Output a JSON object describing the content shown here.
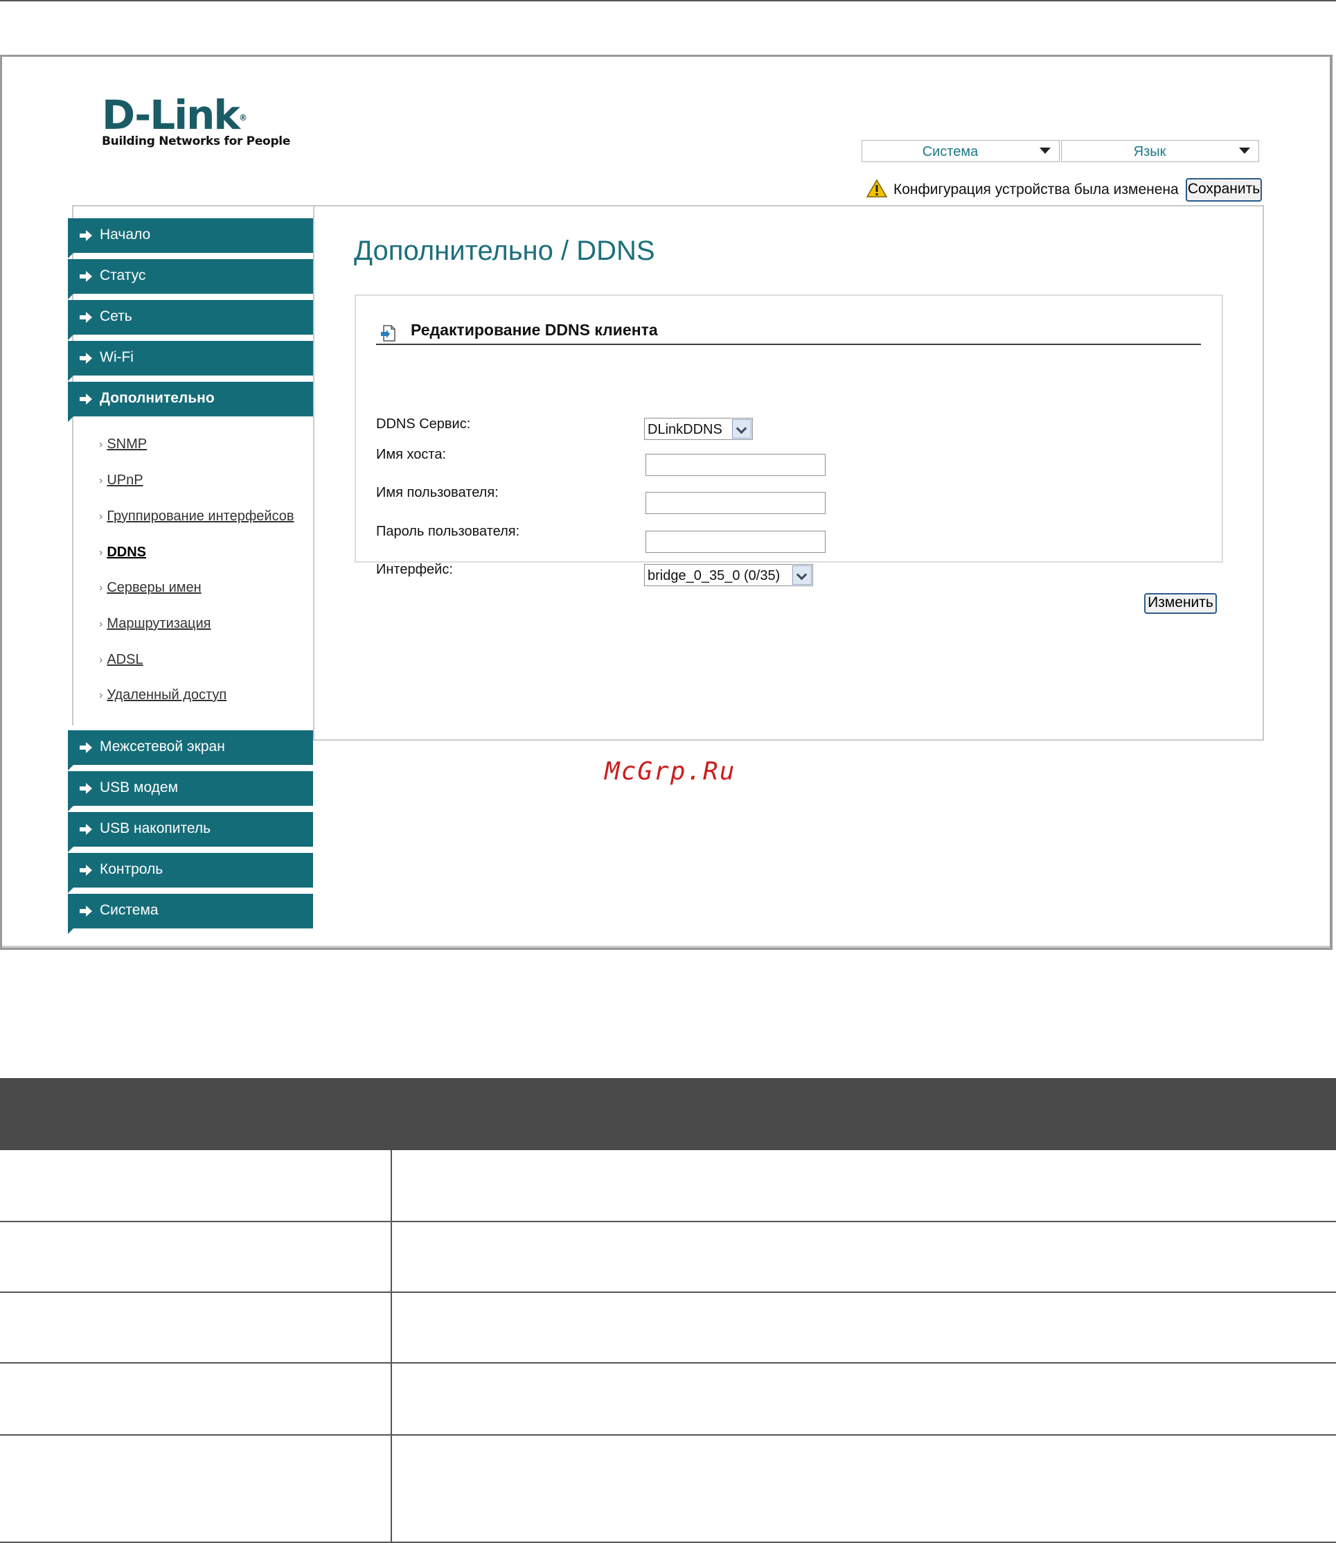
{
  "logo": {
    "brand": "D-Link",
    "registered": "®",
    "tagline": "Building Networks for People"
  },
  "header": {
    "system_menu": "Система",
    "language_menu": "Язык",
    "notice": "Конфигурация устройства была изменена",
    "save_button": "Сохранить"
  },
  "sidebar": {
    "top_items": [
      {
        "label": "Начало"
      },
      {
        "label": "Статус"
      },
      {
        "label": "Сеть"
      },
      {
        "label": "Wi-Fi"
      },
      {
        "label": "Дополнительно",
        "active": true
      }
    ],
    "subitems": [
      {
        "label": "SNMP"
      },
      {
        "label": "UPnP"
      },
      {
        "label": "Группирование интерфейсов"
      },
      {
        "label": "DDNS",
        "active": true
      },
      {
        "label": "Серверы имен"
      },
      {
        "label": "Маршрутизация"
      },
      {
        "label": "ADSL"
      },
      {
        "label": "Удаленный доступ"
      }
    ],
    "bottom_items": [
      {
        "label": "Межсетевой экран"
      },
      {
        "label": "USB модем"
      },
      {
        "label": "USB накопитель"
      },
      {
        "label": "Контроль"
      },
      {
        "label": "Система"
      }
    ]
  },
  "main": {
    "title": "Дополнительно /  DDNS",
    "section_title": "Редактирование DDNS клиента",
    "fields": {
      "service_label": "DDNS Сервис:",
      "service_value": "DLinkDDNS",
      "host_label": "Имя хоста:",
      "host_value": "",
      "user_label": "Имя пользователя:",
      "user_value": "",
      "password_label": "Пароль пользователя:",
      "password_value": "",
      "interface_label": "Интерфейс:",
      "interface_value": "bridge_0_35_0 (0/35)"
    },
    "edit_button": "Изменить"
  },
  "watermark": "McGrp.Ru",
  "colors": {
    "accent": "#156c79",
    "title": "#1d6f7c",
    "table_header": "#4a4a4a"
  }
}
